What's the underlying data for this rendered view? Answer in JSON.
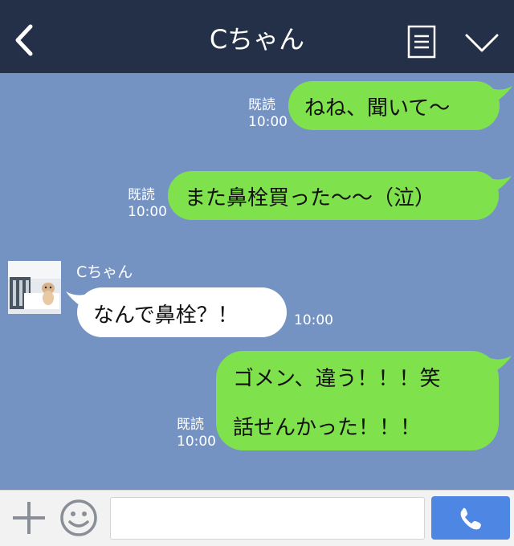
{
  "header": {
    "title": "Cちゃん",
    "back_icon": "chevron-left-icon",
    "memo_icon": "memo-list-icon",
    "menu_icon": "chevron-down-icon"
  },
  "messages": [
    {
      "side": "me",
      "text": "ねね、聞いて〜",
      "read": "既読",
      "time": "10:00"
    },
    {
      "side": "me",
      "text": "また鼻栓買った〜〜（泣）",
      "read": "既読",
      "time": "10:00"
    },
    {
      "side": "them",
      "sender": "Cちゃん",
      "text": "なんで鼻栓？！",
      "time": "10:00"
    },
    {
      "side": "me",
      "lines": [
        "ゴメン、違う！！！笑",
        "話せんかった！！！"
      ],
      "read": "既読",
      "time": "10:00"
    }
  ],
  "composer": {
    "plus_icon": "plus-icon",
    "emoji_icon": "smiley-icon",
    "input_value": "",
    "call_icon": "phone-icon"
  },
  "colors": {
    "header_bg": "#233048",
    "chat_bg": "#7493c3",
    "my_bubble": "#7fe24d",
    "their_bubble": "#ffffff",
    "call_button": "#4e86e4"
  }
}
